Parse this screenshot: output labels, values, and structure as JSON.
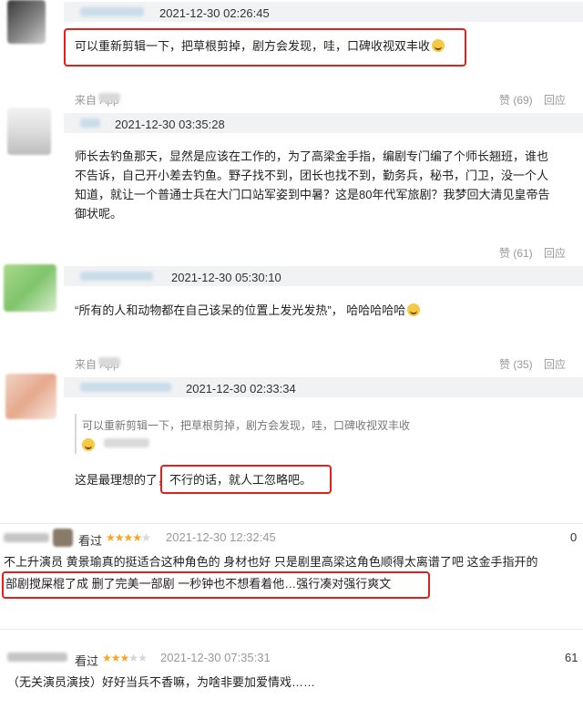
{
  "comments": [
    {
      "time": "2021-12-30 02:26:45",
      "text": "可以重新剪辑一下，把草根剪掉，剧方会发现，哇，口碑收视双丰收",
      "source": "来自 App",
      "like_count": "赞 (69)",
      "reply": "回应"
    },
    {
      "time": "2021-12-30 03:35:28",
      "text_lines": [
        "师长去钓鱼那天，显然是应该在工作的，为了高梁金手指，编剧专门编了个师长翘班，谁也",
        "不告诉，自己开小差去钓鱼。野子找不到，团长也找不到，勤务兵，秘书，门卫，没一个人",
        "知道，就让一个普通士兵在大门口站军姿到中暑？这是80年代军旅剧？我梦回大清见皇帝告",
        "御状呢。"
      ],
      "like_count": "赞 (61)",
      "reply": "回应"
    },
    {
      "time": "2021-12-30 05:30:10",
      "text": "“所有的人和动物都在自己该呆的位置上发光发热”， 哈哈哈哈哈",
      "source": "来自 App",
      "like_count": "赞 (35)",
      "reply": "回应"
    },
    {
      "time": "2021-12-30 02:33:34",
      "quote_text": "可以重新剪辑一下，把草根剪掉，剧方会发现，哇，口碑收视双丰收",
      "text_prefix": "这是最理想的了，",
      "text_highlight": "不行的话，就人工忽略吧。"
    }
  ],
  "reviews": [
    {
      "status": "看过",
      "rating": 4,
      "time": "2021-12-30 12:32:45",
      "votes": "0",
      "line1": "不上升演员 黄景瑜真的挺适合这种角色的 身材也好 只是剧里高梁这角色顺得太离谱了吧 这金手指开的",
      "line2": "部剧搅屎棍了成 删了完美一部剧 一秒钟也不想看着他…强行凑对强行爽文"
    },
    {
      "status": "看过",
      "rating": 3,
      "time": "2021-12-30 07:35:31",
      "votes": "61",
      "line1": "（无关演员演技）好好当兵不香嘛，为啥非要加爱情戏……"
    }
  ],
  "colors": {
    "highlight_border": "#e0211b",
    "star": "#f5a623",
    "meta_text": "#999999"
  },
  "icons": [
    "smile-emoji-icon",
    "star-icon",
    "thumbs-up-icon"
  ]
}
